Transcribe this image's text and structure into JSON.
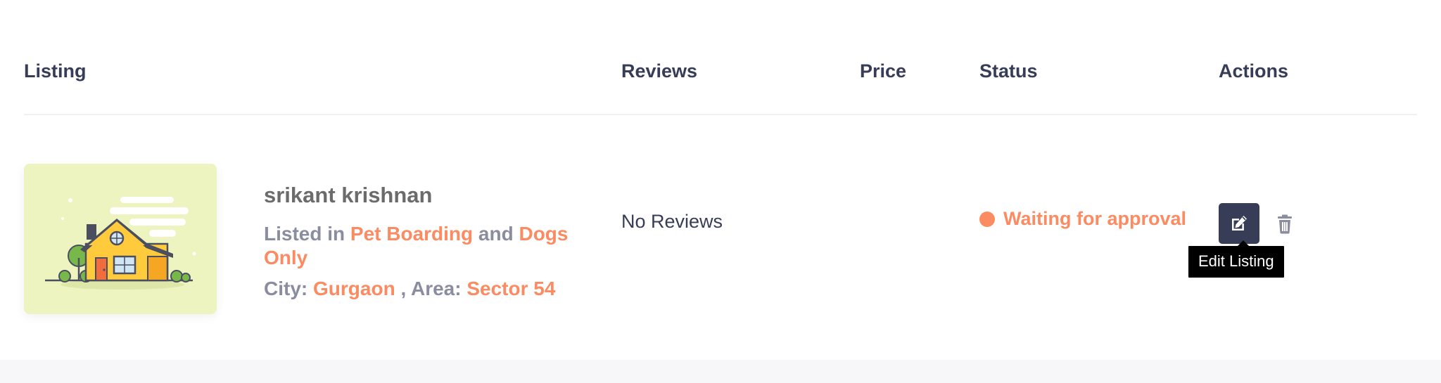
{
  "table": {
    "headers": {
      "listing": "Listing",
      "reviews": "Reviews",
      "price": "Price",
      "status": "Status",
      "actions": "Actions"
    },
    "rows": [
      {
        "thumbnail_icon": "house-illustration",
        "name": "srikant krishnan",
        "listed_in_label": "Listed in",
        "category_1": "Pet Boarding",
        "and_label": "and",
        "category_2": "Dogs Only",
        "city_label": "City:",
        "city": "Gurgaon",
        "area_label": ", Area:",
        "area": "Sector 54",
        "reviews": "No Reviews",
        "price": "",
        "status": "Waiting for approval",
        "status_color": "#fb8b62",
        "actions": {
          "edit_icon": "edit-icon",
          "delete_icon": "trash-icon",
          "edit_tooltip": "Edit Listing"
        }
      }
    ]
  },
  "colors": {
    "heading": "#373c57",
    "accent": "#fb8b62",
    "muted": "#8a8d9f",
    "edit_button_bg": "#373c57"
  }
}
